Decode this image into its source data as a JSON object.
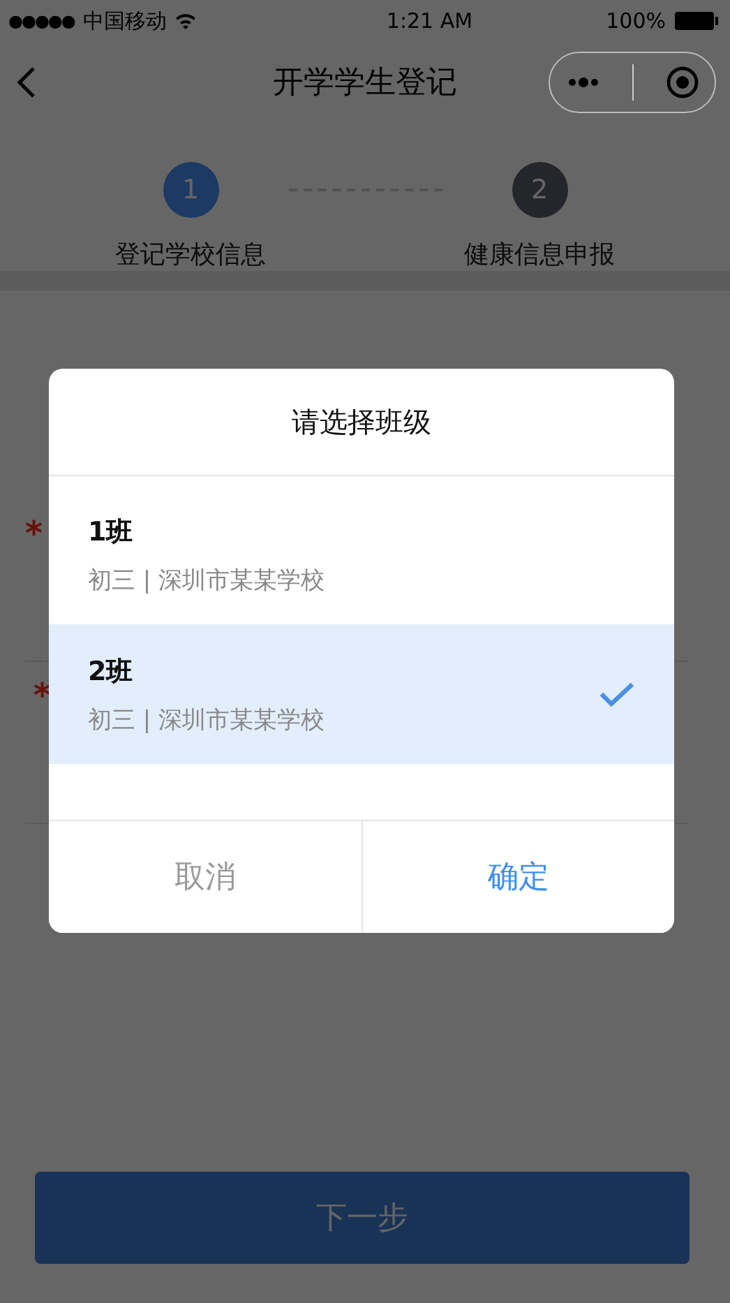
{
  "status_bar": {
    "signal": "●●●●●",
    "carrier": "中国移动",
    "time": "1:21 AM",
    "battery": "100%"
  },
  "nav": {
    "title": "开学学生登记"
  },
  "steps": [
    {
      "number": "1",
      "label": "登记学校信息",
      "selected": true
    },
    {
      "number": "2",
      "label": "健康信息申报",
      "selected": false
    }
  ],
  "form_fields": [
    {
      "required_mark": "*"
    },
    {
      "required_mark": "*"
    }
  ],
  "next_button": {
    "label": "下一步",
    "disabled": true
  },
  "dialog": {
    "title": "请选择班级",
    "options": [
      {
        "name": "1班",
        "detail": "初三 | 深圳市某某学校",
        "selected": false
      },
      {
        "name": "2班",
        "detail": "初三 | 深圳市某某学校",
        "selected": true
      }
    ],
    "cancel": "取消",
    "confirm": "确定"
  }
}
